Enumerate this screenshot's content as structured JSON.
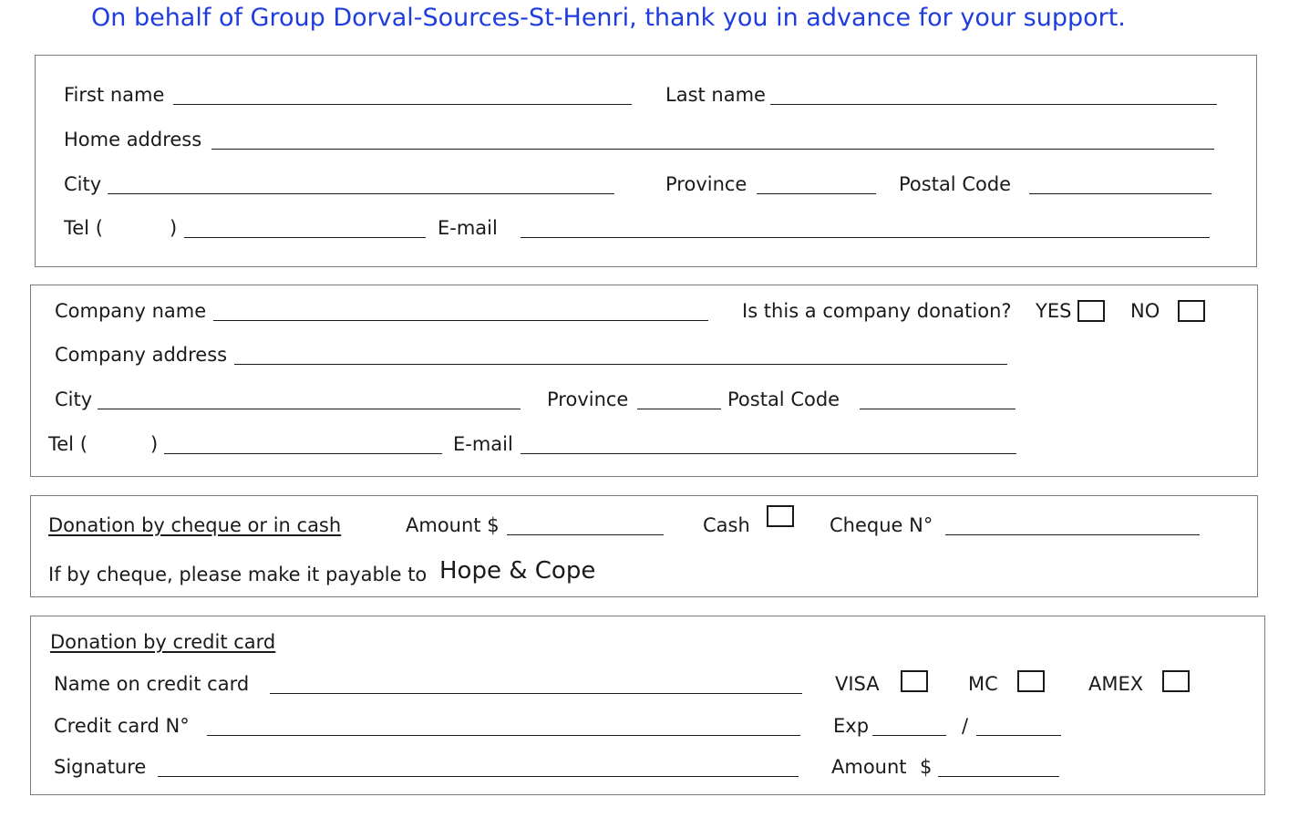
{
  "header": {
    "title": "On behalf of Group Dorval-Sources-St-Henri, thank you in advance for your support."
  },
  "personal": {
    "first_name": "First name",
    "last_name": "Last name",
    "home_address": "Home address",
    "city": "City",
    "province": "Province",
    "postal_code": "Postal Code",
    "tel_open": "Tel (",
    "tel_close": ")",
    "email": "E-mail"
  },
  "company": {
    "company_name": "Company name",
    "question": "Is this a company donation?",
    "yes": "YES",
    "no": "NO",
    "company_address": "Company address",
    "city": "City",
    "province": "Province",
    "postal_code": "Postal Code",
    "tel_open": "Tel (",
    "tel_close": ")",
    "email": "E-mail"
  },
  "cheque": {
    "heading": "Donation by cheque or in cash",
    "amount": "Amount $",
    "cash": "Cash",
    "cheque_no": "Cheque N°",
    "payable_prefix": "If by cheque, please make it payable to",
    "payee": "Hope & Cope"
  },
  "card": {
    "heading": "Donation by credit card",
    "name_on_card": "Name on credit card",
    "visa": "VISA",
    "mc": "MC",
    "amex": "AMEX",
    "card_no": "Credit card N°",
    "exp": "Exp",
    "slash": "/",
    "signature": "Signature",
    "amount": "Amount",
    "dollar": "$"
  }
}
